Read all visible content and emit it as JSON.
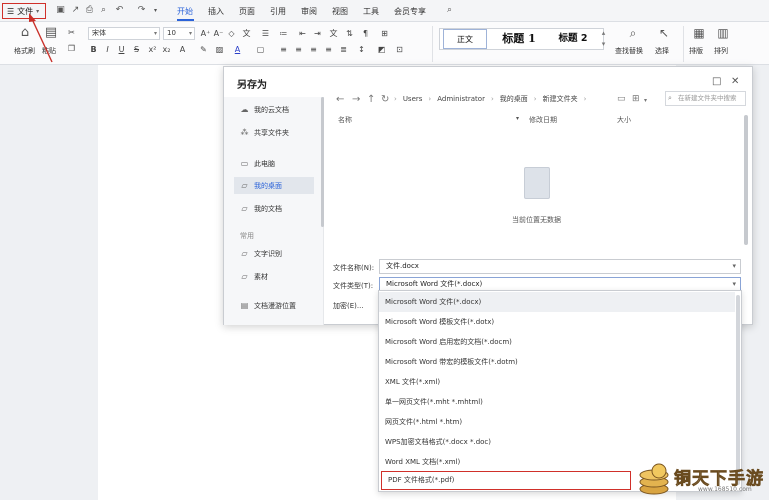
{
  "menubar": {
    "file_label": "文件",
    "tabs": [
      "开始",
      "插入",
      "页面",
      "引用",
      "审阅",
      "视图",
      "工具",
      "会员专享"
    ]
  },
  "ribbon": {
    "format_painter": "格式刷",
    "paste": "粘贴",
    "font_name": "宋体",
    "font_size": "10",
    "styles": [
      "正文",
      "标题 1",
      "标题 2"
    ],
    "find_replace": "查找替换",
    "select": "选择",
    "sort": "排版",
    "arrange": "排列"
  },
  "dialog": {
    "title": "另存为",
    "sidebar": [
      {
        "label": "我的云文档",
        "icon": "cloud-icon"
      },
      {
        "label": "共享文件夹",
        "icon": "share-icon"
      },
      {
        "label": "此电脑",
        "icon": "computer-icon"
      },
      {
        "label": "我的桌面",
        "icon": "folder-icon",
        "active": true
      },
      {
        "label": "我的文档",
        "icon": "folder-icon"
      }
    ],
    "section_label": "常用",
    "sidebar_common": [
      {
        "label": "文字识别",
        "icon": "folder-icon"
      },
      {
        "label": "素材",
        "icon": "folder-icon"
      },
      {
        "label": "文档漫游位置",
        "icon": "document-icon"
      }
    ],
    "breadcrumb": [
      "Users",
      "Administrator",
      "我的桌面",
      "新建文件夹"
    ],
    "search_placeholder": "在新建文件夹中搜索",
    "columns": {
      "name": "名称",
      "modified": "修改日期",
      "size": "大小"
    },
    "empty_text": "当前位置无数据",
    "filename_label": "文件名称(N):",
    "filename_value": "文件.docx",
    "filetype_label": "文件类型(T):",
    "filetype_value": "Microsoft Word 文件(*.docx)",
    "encrypt_label": "加密(E)..."
  },
  "type_options": [
    "Microsoft Word 文件(*.docx)",
    "Microsoft Word 模板文件(*.dotx)",
    "Microsoft Word 启用宏的文档(*.docm)",
    "Microsoft Word 带宏的模板文件(*.dotm)",
    "XML 文件(*.xml)",
    "单一网页文件(*.mht *.mhtml)",
    "网页文件(*.html *.htm)",
    "WPS加密文档格式(*.docx *.doc)",
    "Word XML 文档(*.xml)",
    "PDF 文件格式(*.pdf)"
  ],
  "watermark": {
    "text": "铜天下手游",
    "url": "www.168510.com"
  },
  "colors": {
    "accent": "#2b63d9",
    "highlight": "#d0302a"
  }
}
